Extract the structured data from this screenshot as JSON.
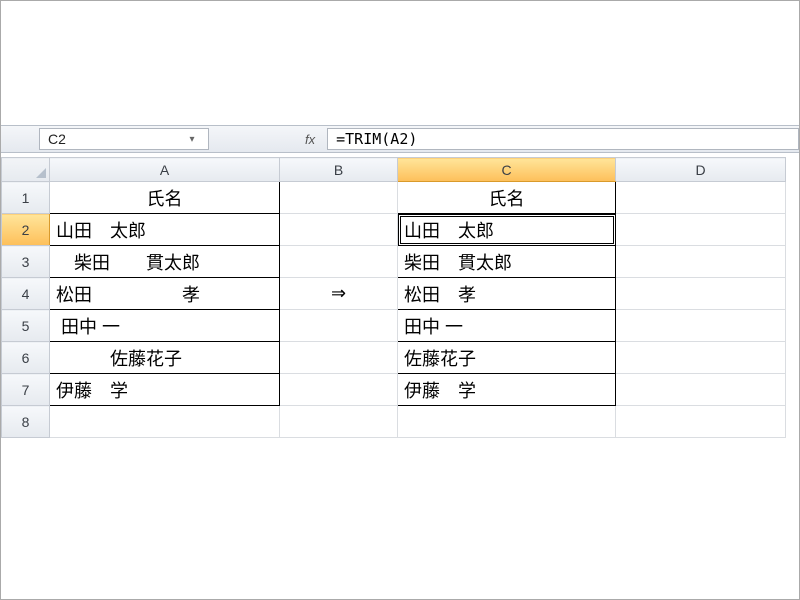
{
  "nameBox": {
    "value": "C2"
  },
  "fxLabel": "fx",
  "formula": "=TRIM(A2)",
  "columns": [
    "A",
    "B",
    "C",
    "D"
  ],
  "rowNumbers": [
    "1",
    "2",
    "3",
    "4",
    "5",
    "6",
    "7",
    "8"
  ],
  "activeCell": {
    "row": 2,
    "col": "C"
  },
  "arrowSymbol": "⇒",
  "tableA": {
    "header": "氏名",
    "rows": [
      "山田　太郎",
      "　柴田　　貫太郎",
      "松田　　　　　孝",
      " 田中 一",
      "　　　佐藤花子",
      "伊藤　学"
    ]
  },
  "tableC": {
    "header": "氏名",
    "rows": [
      "山田　太郎",
      "柴田　貫太郎",
      "松田　孝",
      "田中 一",
      "佐藤花子",
      "伊藤　学"
    ]
  }
}
